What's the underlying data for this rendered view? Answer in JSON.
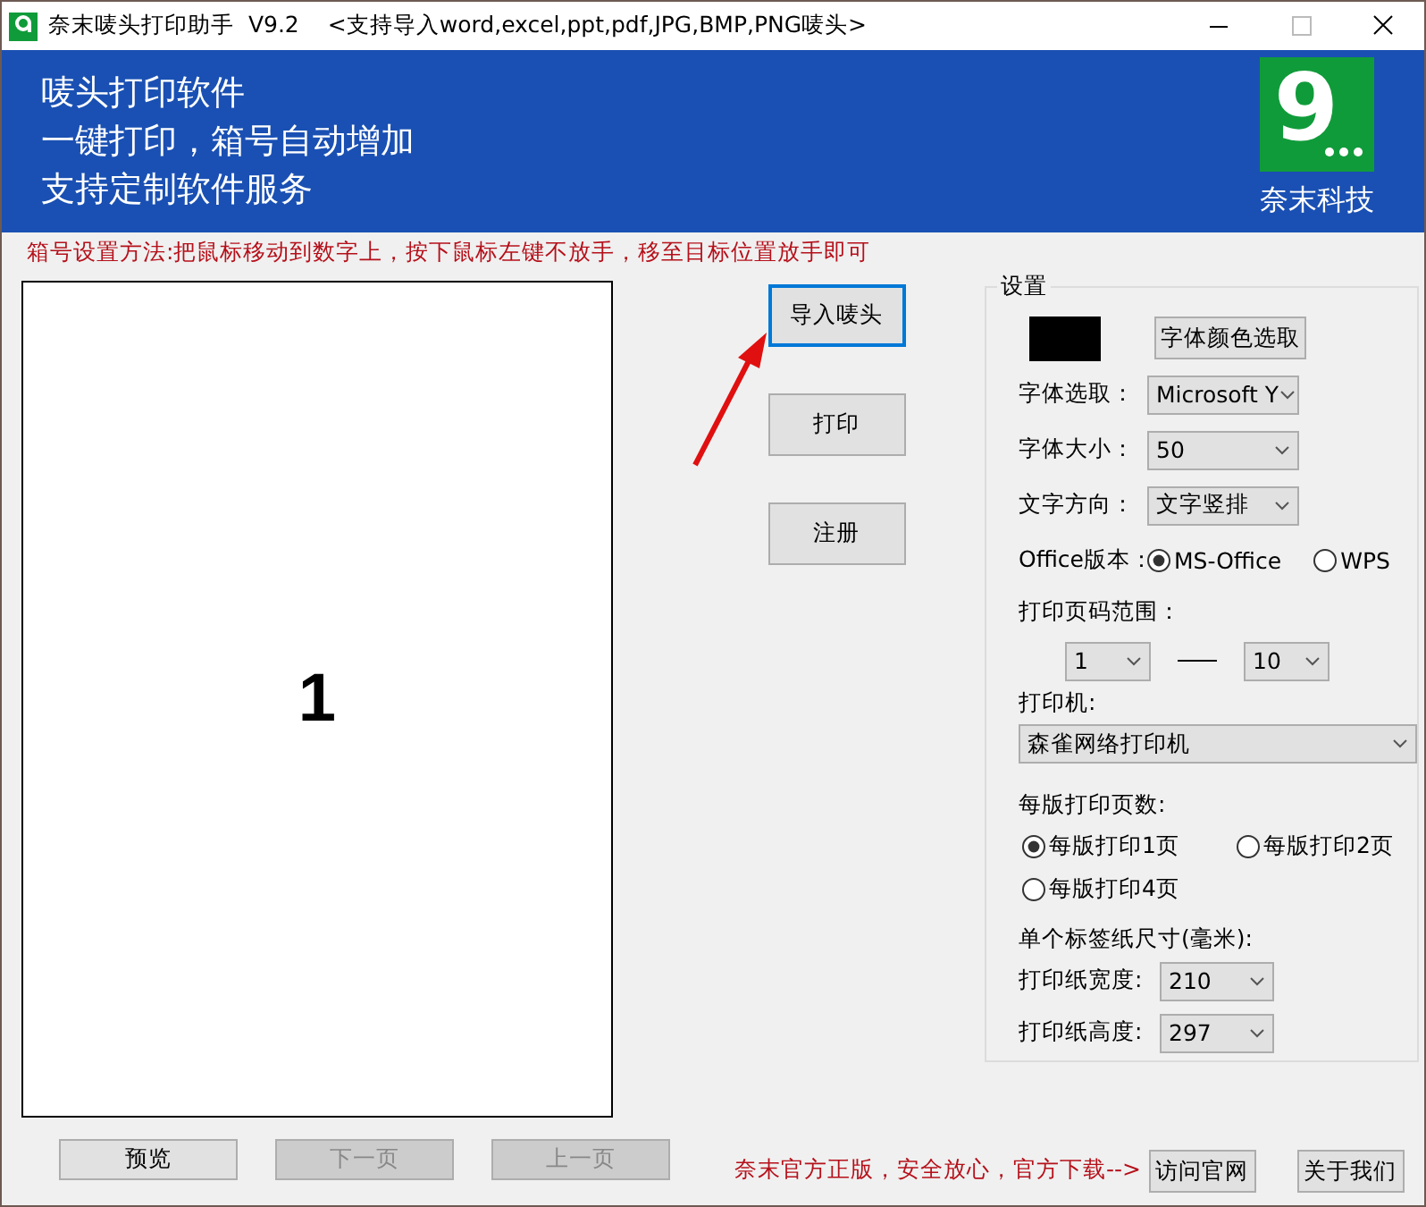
{
  "window": {
    "title": "奈末唛头打印助手  V9.2",
    "subtitle": "<支持导入word,excel,ppt,pdf,JPG,BMP,PNG唛头>"
  },
  "banner": {
    "lines": [
      "唛头打印软件",
      "一键打印，箱号自动增加",
      "支持定制软件服务"
    ],
    "logo_text": "9",
    "company": "奈末科技"
  },
  "hint": "箱号设置方法:把鼠标移动到数字上，按下鼠标左键不放手，移至目标位置放手即可",
  "preview": {
    "number": "1"
  },
  "actions": [
    {
      "label": "导入唛头",
      "focused": true
    },
    {
      "label": "打印",
      "focused": false
    },
    {
      "label": "注册",
      "focused": false
    }
  ],
  "settings": {
    "title": "设置",
    "swatch": {
      "color": "#000000"
    },
    "color_button": "字体颜色选取",
    "fields": [
      {
        "label": "字体选取：",
        "value": "Microsoft Y"
      },
      {
        "label": "字体大小：",
        "value": "50"
      },
      {
        "label": "文字方向：",
        "value": "文字竖排"
      }
    ],
    "office": {
      "label": "Office版本：",
      "options": [
        {
          "label": "MS-Office",
          "selected": true
        },
        {
          "label": "WPS",
          "selected": false
        }
      ]
    },
    "page_range": {
      "label": "打印页码范围：",
      "from": "1",
      "to": "10"
    },
    "printer": {
      "label": "打印机:",
      "value": "森雀网络打印机"
    },
    "per_sheet": {
      "label": "每版打印页数:",
      "options": [
        {
          "label": "每版打印1页",
          "selected": true
        },
        {
          "label": "每版打印2页",
          "selected": false
        },
        {
          "label": "每版打印4页",
          "selected": false
        }
      ]
    },
    "paper": {
      "label": "单个标签纸尺寸(毫米):",
      "fields": [
        {
          "label": "打印纸宽度:",
          "value": "210"
        },
        {
          "label": "打印纸高度:",
          "value": "297"
        }
      ]
    }
  },
  "nav_buttons": [
    {
      "label": "预览",
      "disabled": false
    },
    {
      "label": "下一页",
      "disabled": true
    },
    {
      "label": "上一页",
      "disabled": true
    }
  ],
  "footer": {
    "note": "奈末官方正版，安全放心，官方下载-->",
    "buttons": [
      "访问官网",
      "关于我们"
    ]
  }
}
